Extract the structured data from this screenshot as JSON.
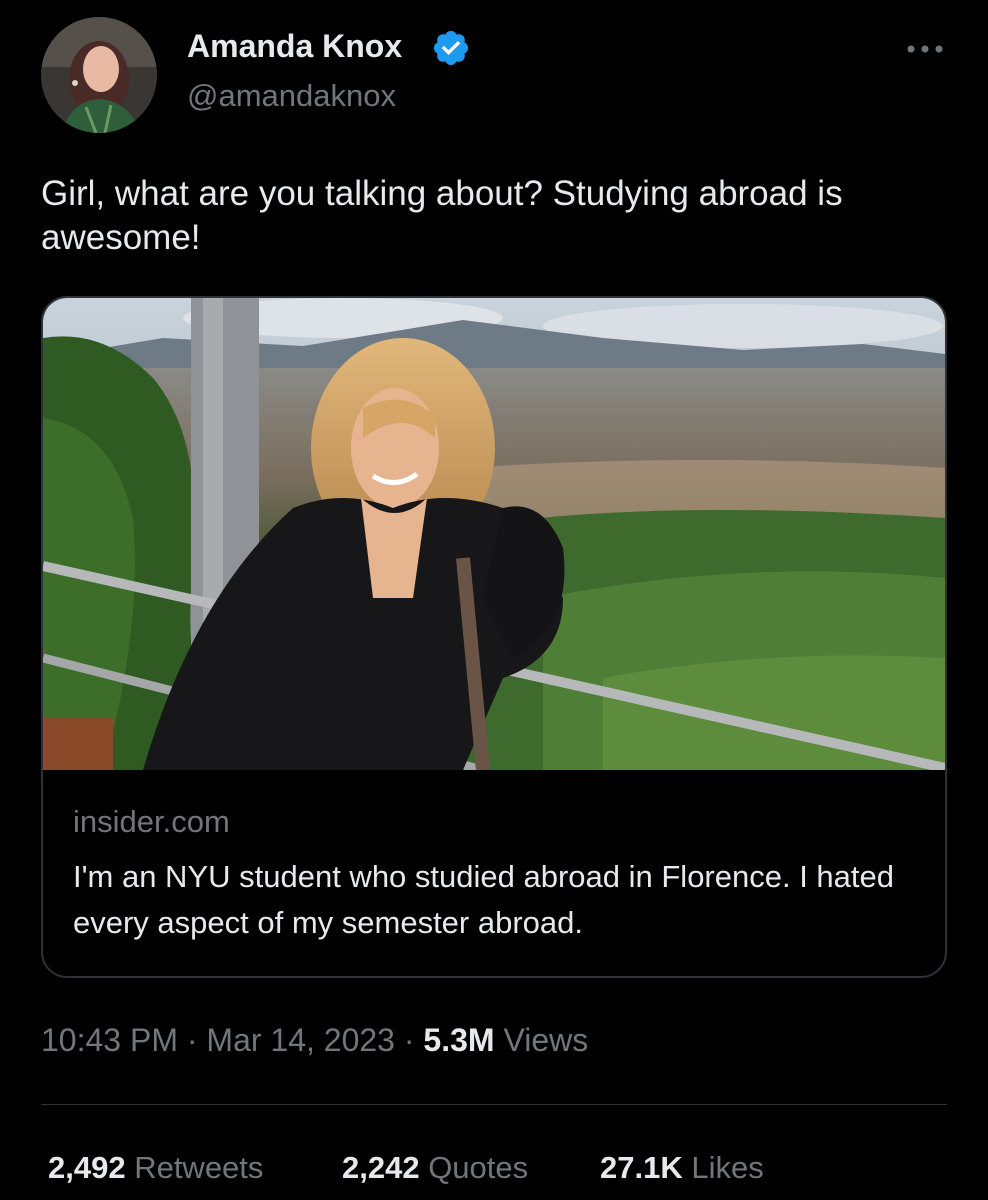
{
  "author": {
    "name": "Amanda Knox",
    "handle": "@amandaknox",
    "verified": true,
    "verified_color": "#1d9bf0"
  },
  "more_menu_icon": "more-dots-icon",
  "tweet": {
    "text": "Girl, what are you talking about? Studying abroad is awesome!"
  },
  "link_card": {
    "image_icon": "photo-woman-overlooking-florence",
    "domain": "insider.com",
    "title": "I'm an NYU student who studied abroad in Florence. I hated every aspect of my semester abroad."
  },
  "meta": {
    "time": "10:43 PM",
    "separator1": " · ",
    "date": "Mar 14, 2023",
    "separator2": " · ",
    "views_count": "5.3M",
    "views_label": " Views"
  },
  "stats": [
    {
      "count": "2,492",
      "label": " Retweets"
    },
    {
      "count": "2,242",
      "label": " Quotes"
    },
    {
      "count": "27.1K",
      "label": " Likes"
    }
  ],
  "colors": {
    "background": "#000000",
    "primary_text": "#e7e9ea",
    "secondary_text": "#71767b",
    "border": "#2f3336"
  }
}
